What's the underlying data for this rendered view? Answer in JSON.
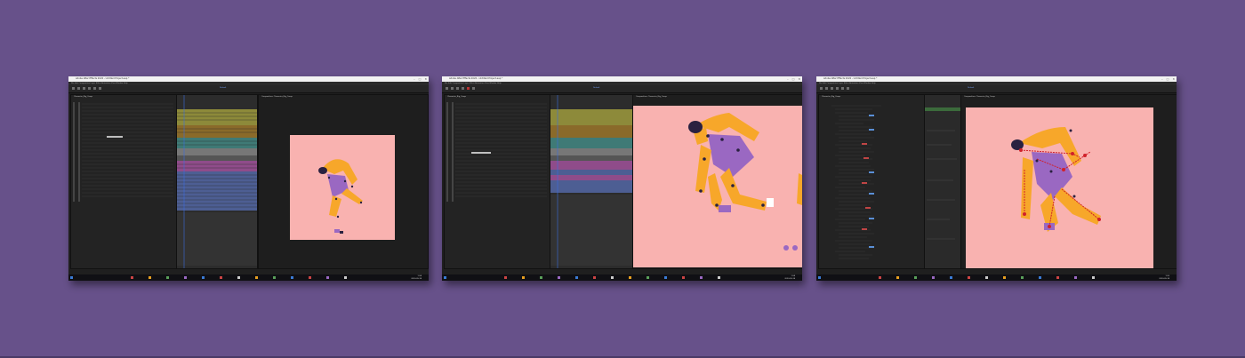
{
  "shots": [
    {
      "title": "Adobe After Effects 2020 - Untitled Project.aep *",
      "menu": "File   Edit   Composition   Layer   Effect   Animation   View   Window   Help",
      "workspace": "Default",
      "project_tab": "Project",
      "timeline_tab": "Character_Rig_Comp",
      "comp_tab": "Composition: Character_Rig_Comp",
      "clock_time": "1:58",
      "clock_date": "2020-05-14"
    },
    {
      "title": "Adobe After Effects 2020 - Untitled Project.aep *",
      "menu": "File   Edit   Composition   Layer   Effect   Animation   View   Window   Help",
      "workspace": "Default",
      "project_tab": "Project",
      "timeline_tab": "Character_Rig_Comp",
      "comp_tab": "Composition: Character_Rig_Comp",
      "clock_time": "1:58",
      "clock_date": "2020-05-14"
    },
    {
      "title": "Adobe After Effects 2020 - Untitled Project.aep *",
      "menu": "File   Edit   Composition   Layer   Effect   Animation   View   Window   Help",
      "workspace": "Default",
      "project_tab": "Project",
      "timeline_tab": "Character_Rig_Comp",
      "comp_tab": "Composition: Character_Rig_Comp",
      "clock_time": "1:59",
      "clock_date": "2020-05-14"
    }
  ],
  "colors": {
    "background": "#67518a",
    "canvas_pink": "#f9b2b0",
    "skin_orange": "#f7a72a",
    "outfit_purple": "#9a68c2",
    "hair_dark": "#2a2140",
    "label_yellow": "#8d8a3a",
    "label_brown": "#8a6a2a",
    "label_teal": "#3f7a76",
    "label_magenta": "#8f4c8a",
    "label_blue": "#4d5e93"
  },
  "icons": [
    "window-minimize-icon",
    "window-maximize-icon",
    "window-close-icon",
    "windows-start-icon"
  ]
}
